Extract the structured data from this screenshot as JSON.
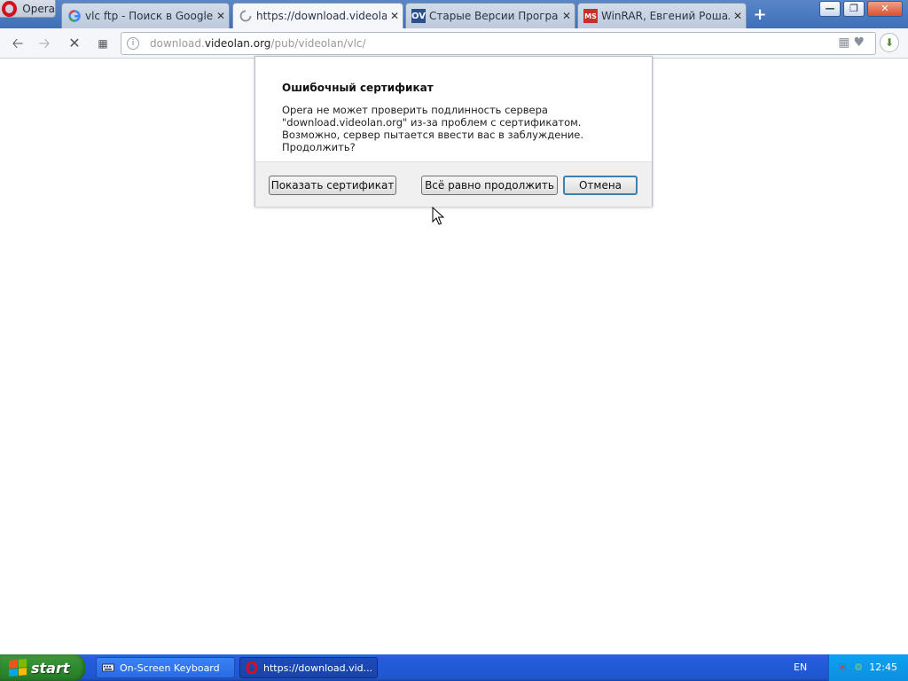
{
  "browser": {
    "menu_label": "Opera",
    "tabs": [
      {
        "title": "vlc ftp - Поиск в Google",
        "icon": "google-icon"
      },
      {
        "title": "https://download.videolan",
        "icon": "loading-spinner-icon",
        "active": true
      },
      {
        "title": "Старые Версии Програм",
        "icon": "ov-site-icon",
        "icon_text": "OV"
      },
      {
        "title": "WinRAR, Евгений Рошал",
        "icon": "ms-site-icon",
        "icon_text": "MS"
      }
    ],
    "close_glyph": "✕",
    "new_tab_glyph": "+"
  },
  "navigation": {
    "url_host_prefix": "download.",
    "url_host": "videolan.org",
    "url_path": "/pub/videolan/vlc/"
  },
  "dialog": {
    "title": "Ошибочный сертификат",
    "message": "Opera не может проверить подлинность сервера \"download.videolan.org\" из-за проблем с сертификатом. Возможно, сервер пытается ввести вас в заблуждение. Продолжить?",
    "show_cert_label": "Показать сертификат",
    "continue_label": "Всё равно продолжить",
    "cancel_label": "Отмена"
  },
  "taskbar": {
    "start_label": "start",
    "items": [
      {
        "label": "On-Screen Keyboard",
        "icon": "keyboard-icon"
      },
      {
        "label": "https://download.vid...",
        "icon": "opera-icon",
        "active": true
      }
    ],
    "language": "EN",
    "clock": "12:45"
  },
  "colors": {
    "opera_red": "#d40f1e",
    "xp_blue": "#245edb",
    "xp_green": "#2f8a2f",
    "default_button_border": "#3c7fb1"
  }
}
